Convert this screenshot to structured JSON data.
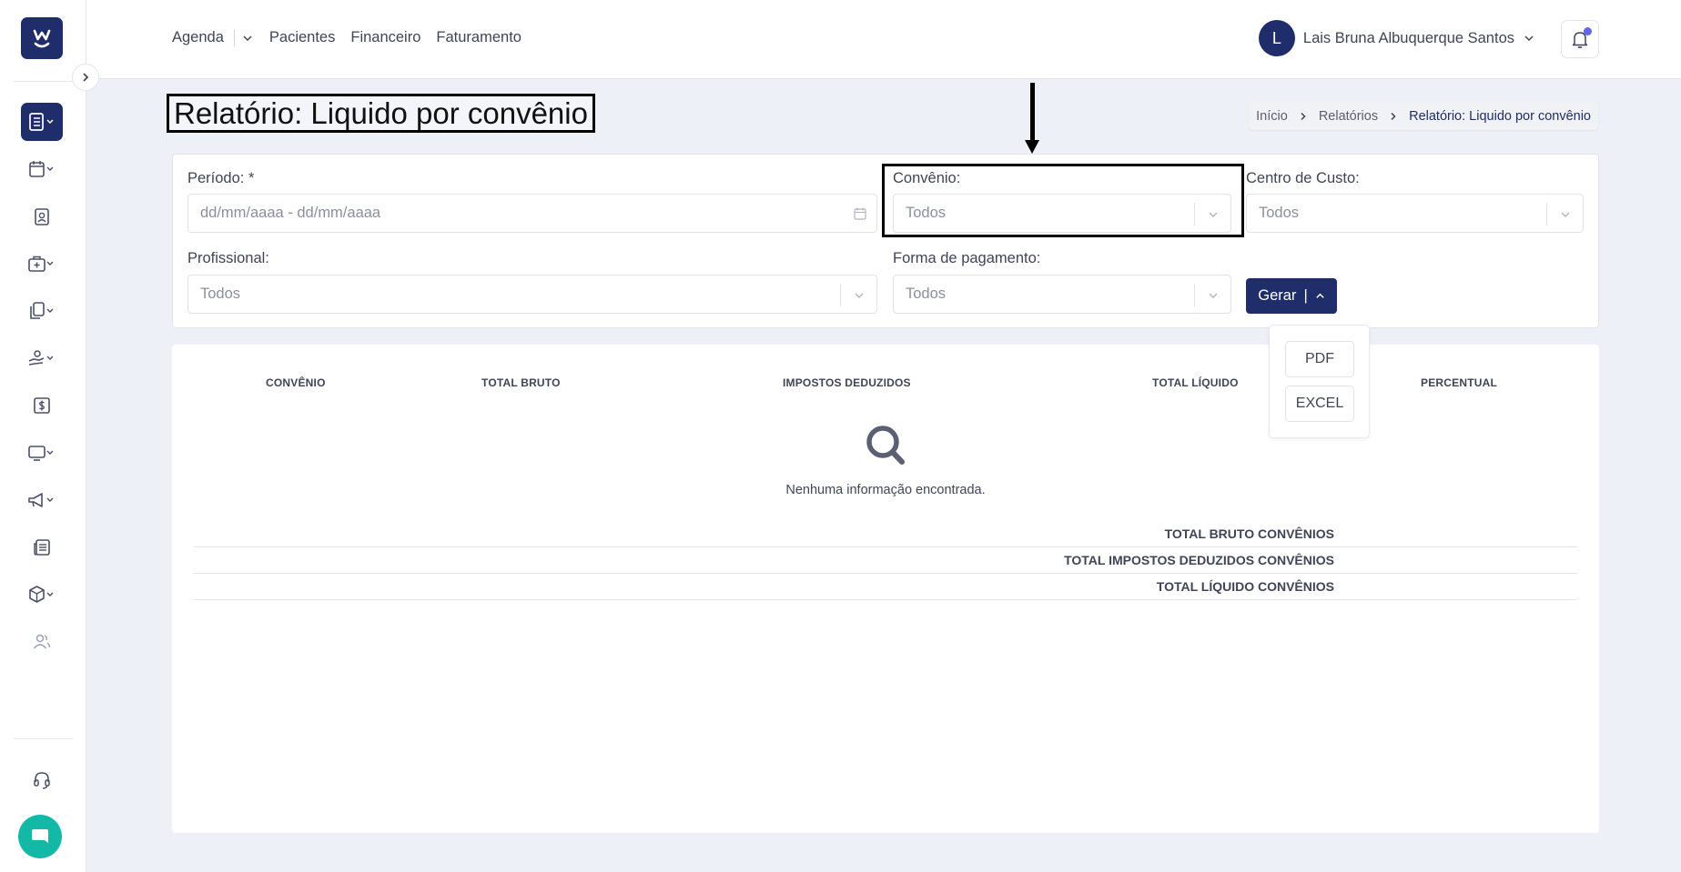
{
  "sidebar": {
    "logo_icon": "w-smile-logo",
    "items": [
      {
        "name": "sidebar-item-reports",
        "icon": "report-list-icon",
        "active": true,
        "has_dropdown": true
      },
      {
        "name": "sidebar-item-calendar",
        "icon": "calendar-icon",
        "has_dropdown": true
      },
      {
        "name": "sidebar-item-patients",
        "icon": "patient-badge-icon"
      },
      {
        "name": "sidebar-item-medical",
        "icon": "medical-bag-icon",
        "has_dropdown": true
      },
      {
        "name": "sidebar-item-documents",
        "icon": "documents-icon",
        "has_dropdown": true
      },
      {
        "name": "sidebar-item-payments",
        "icon": "hand-money-icon",
        "has_dropdown": true
      },
      {
        "name": "sidebar-item-finance",
        "icon": "dollar-doc-icon"
      },
      {
        "name": "sidebar-item-monitor",
        "icon": "monitor-icon",
        "has_dropdown": true
      },
      {
        "name": "sidebar-item-marketing",
        "icon": "megaphone-icon",
        "has_dropdown": true
      },
      {
        "name": "sidebar-item-news",
        "icon": "newspaper-icon"
      },
      {
        "name": "sidebar-item-inventory",
        "icon": "box-icon",
        "has_dropdown": true
      },
      {
        "name": "sidebar-item-users",
        "icon": "users-icon"
      }
    ],
    "support_icon": "headset-icon",
    "chat_icon": "chat-bubble-icon"
  },
  "topnav": {
    "items": [
      "Agenda",
      "Pacientes",
      "Financeiro",
      "Faturamento"
    ],
    "user_initial": "L",
    "user_name": "Lais Bruna Albuquerque Santos",
    "notification_icon": "bell-icon"
  },
  "page": {
    "title": "Relatório: Liquido por convênio",
    "breadcrumb": [
      "Início",
      "Relatórios",
      "Relatório: Liquido por convênio"
    ]
  },
  "filters": {
    "periodo": {
      "label": "Período: *",
      "placeholder": "dd/mm/aaaa - dd/mm/aaaa"
    },
    "convenio": {
      "label": "Convênio:",
      "value": "Todos"
    },
    "centro_custo": {
      "label": "Centro de Custo:",
      "value": "Todos"
    },
    "profissional": {
      "label": "Profissional:",
      "value": "Todos"
    },
    "forma_pagamento": {
      "label": "Forma de pagamento:",
      "value": "Todos"
    },
    "gerar_label": "Gerar",
    "gerar_options": [
      "PDF",
      "EXCEL"
    ]
  },
  "table": {
    "columns": [
      "CONVÊNIO",
      "TOTAL BRUTO",
      "IMPOSTOS DEDUZIDOS",
      "TOTAL LÍQUIDO",
      "PERCENTUAL"
    ],
    "empty_message": "Nenhuma informação encontrada.",
    "totals": [
      "TOTAL BRUTO CONVÊNIOS",
      "TOTAL IMPOSTOS DEDUZIDOS CONVÊNIOS",
      "TOTAL LÍQUIDO CONVÊNIOS"
    ]
  },
  "colors": {
    "primary": "#1f2d6b",
    "accent_dot": "#6366f1",
    "chat": "#14b8a6"
  }
}
